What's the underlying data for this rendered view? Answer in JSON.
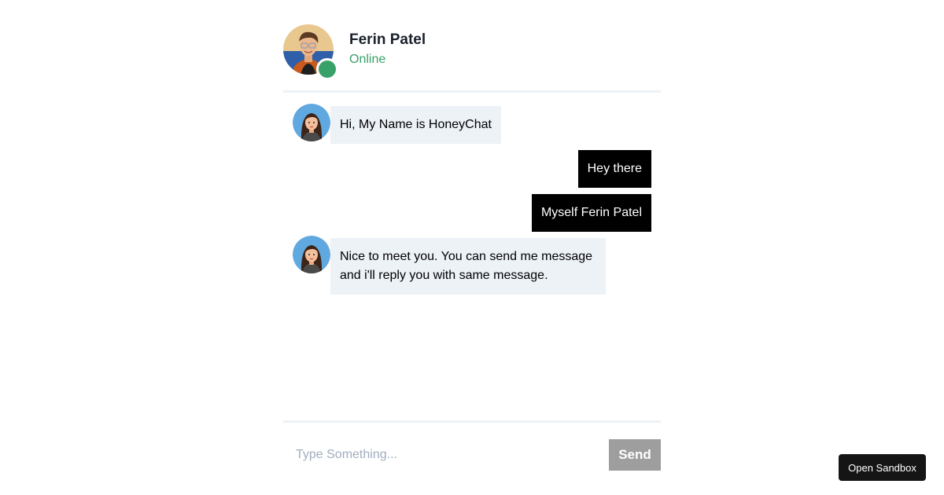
{
  "header": {
    "name": "Ferin Patel",
    "status": "Online"
  },
  "messages": [
    {
      "sender": "bot",
      "text": "Hi, My Name is HoneyChat"
    },
    {
      "sender": "user",
      "text": "Hey there"
    },
    {
      "sender": "user",
      "text": "Myself Ferin Patel"
    },
    {
      "sender": "bot",
      "text_line1": "Nice to meet you. You can send me message",
      "text_line2": "and i'll reply you with same message."
    }
  ],
  "composer": {
    "placeholder": "Type Something...",
    "send_label": "Send"
  },
  "sandbox_label": "Open Sandbox",
  "colors": {
    "online": "#38a169",
    "bot_bubble": "#edf2f7",
    "user_bubble": "#000000",
    "send_button": "#9e9e9e"
  }
}
